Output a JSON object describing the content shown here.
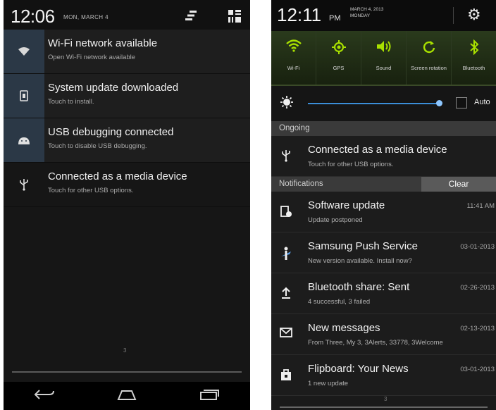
{
  "left": {
    "status_bar": {
      "time": "12:06",
      "date": "MON, MARCH 4"
    },
    "notifications": [
      {
        "title": "Wi-Fi network available",
        "subtitle": "Open Wi-Fi network available",
        "icon": "wifi-icon"
      },
      {
        "title": "System update downloaded",
        "subtitle": "Touch to install.",
        "icon": "system-update-icon"
      },
      {
        "title": "USB debugging connected",
        "subtitle": "Touch to disable USB debugging.",
        "icon": "android-debug-icon"
      },
      {
        "title": "Connected as a media device",
        "subtitle": "Touch for other USB options.",
        "icon": "usb-icon"
      }
    ],
    "page_indicator": "3",
    "nav_icons": [
      "back-icon",
      "home-icon",
      "recent-apps-icon"
    ]
  },
  "right": {
    "status_bar": {
      "time": "12:11",
      "ampm": "PM",
      "date_line1": "MARCH 4, 2013",
      "date_line2": "MONDAY"
    },
    "quick_settings": [
      {
        "label": "Wi-Fi",
        "icon": "wifi-icon"
      },
      {
        "label": "GPS",
        "icon": "gps-icon"
      },
      {
        "label": "Sound",
        "icon": "sound-icon"
      },
      {
        "label": "Screen rotation",
        "icon": "rotation-icon"
      },
      {
        "label": "Bluetooth",
        "icon": "bluetooth-icon"
      }
    ],
    "brightness": {
      "auto_label": "Auto",
      "level": 0.95
    },
    "ongoing_header": "Ongoing",
    "ongoing": {
      "title": "Connected as a media device",
      "subtitle": "Touch for other USB options."
    },
    "notifications_header": "Notifications",
    "clear_label": "Clear",
    "notifications": [
      {
        "title": "Software update",
        "subtitle": "Update postponed",
        "time": "11:41 AM",
        "icon": "software-update-icon"
      },
      {
        "title": "Samsung Push Service",
        "subtitle": "New version available. Install now?",
        "time": "03-01-2013",
        "icon": "samsung-push-icon"
      },
      {
        "title": "Bluetooth share: Sent",
        "subtitle": "4 successful, 3 failed",
        "time": "02-26-2013",
        "icon": "upload-icon"
      },
      {
        "title": "New messages",
        "subtitle": "From Three, My 3, 3Alerts, 33778, 3Welcome",
        "time": "02-13-2013",
        "icon": "message-icon"
      },
      {
        "title": "Flipboard: Your News",
        "subtitle": "1 new update",
        "time": "03-01-2013",
        "icon": "flipboard-icon"
      }
    ],
    "page_indicator": "3"
  },
  "colors": {
    "accent_green": "#a8e000",
    "slider_blue": "#3b8ed8",
    "highlight_bg": "#2b3846"
  }
}
